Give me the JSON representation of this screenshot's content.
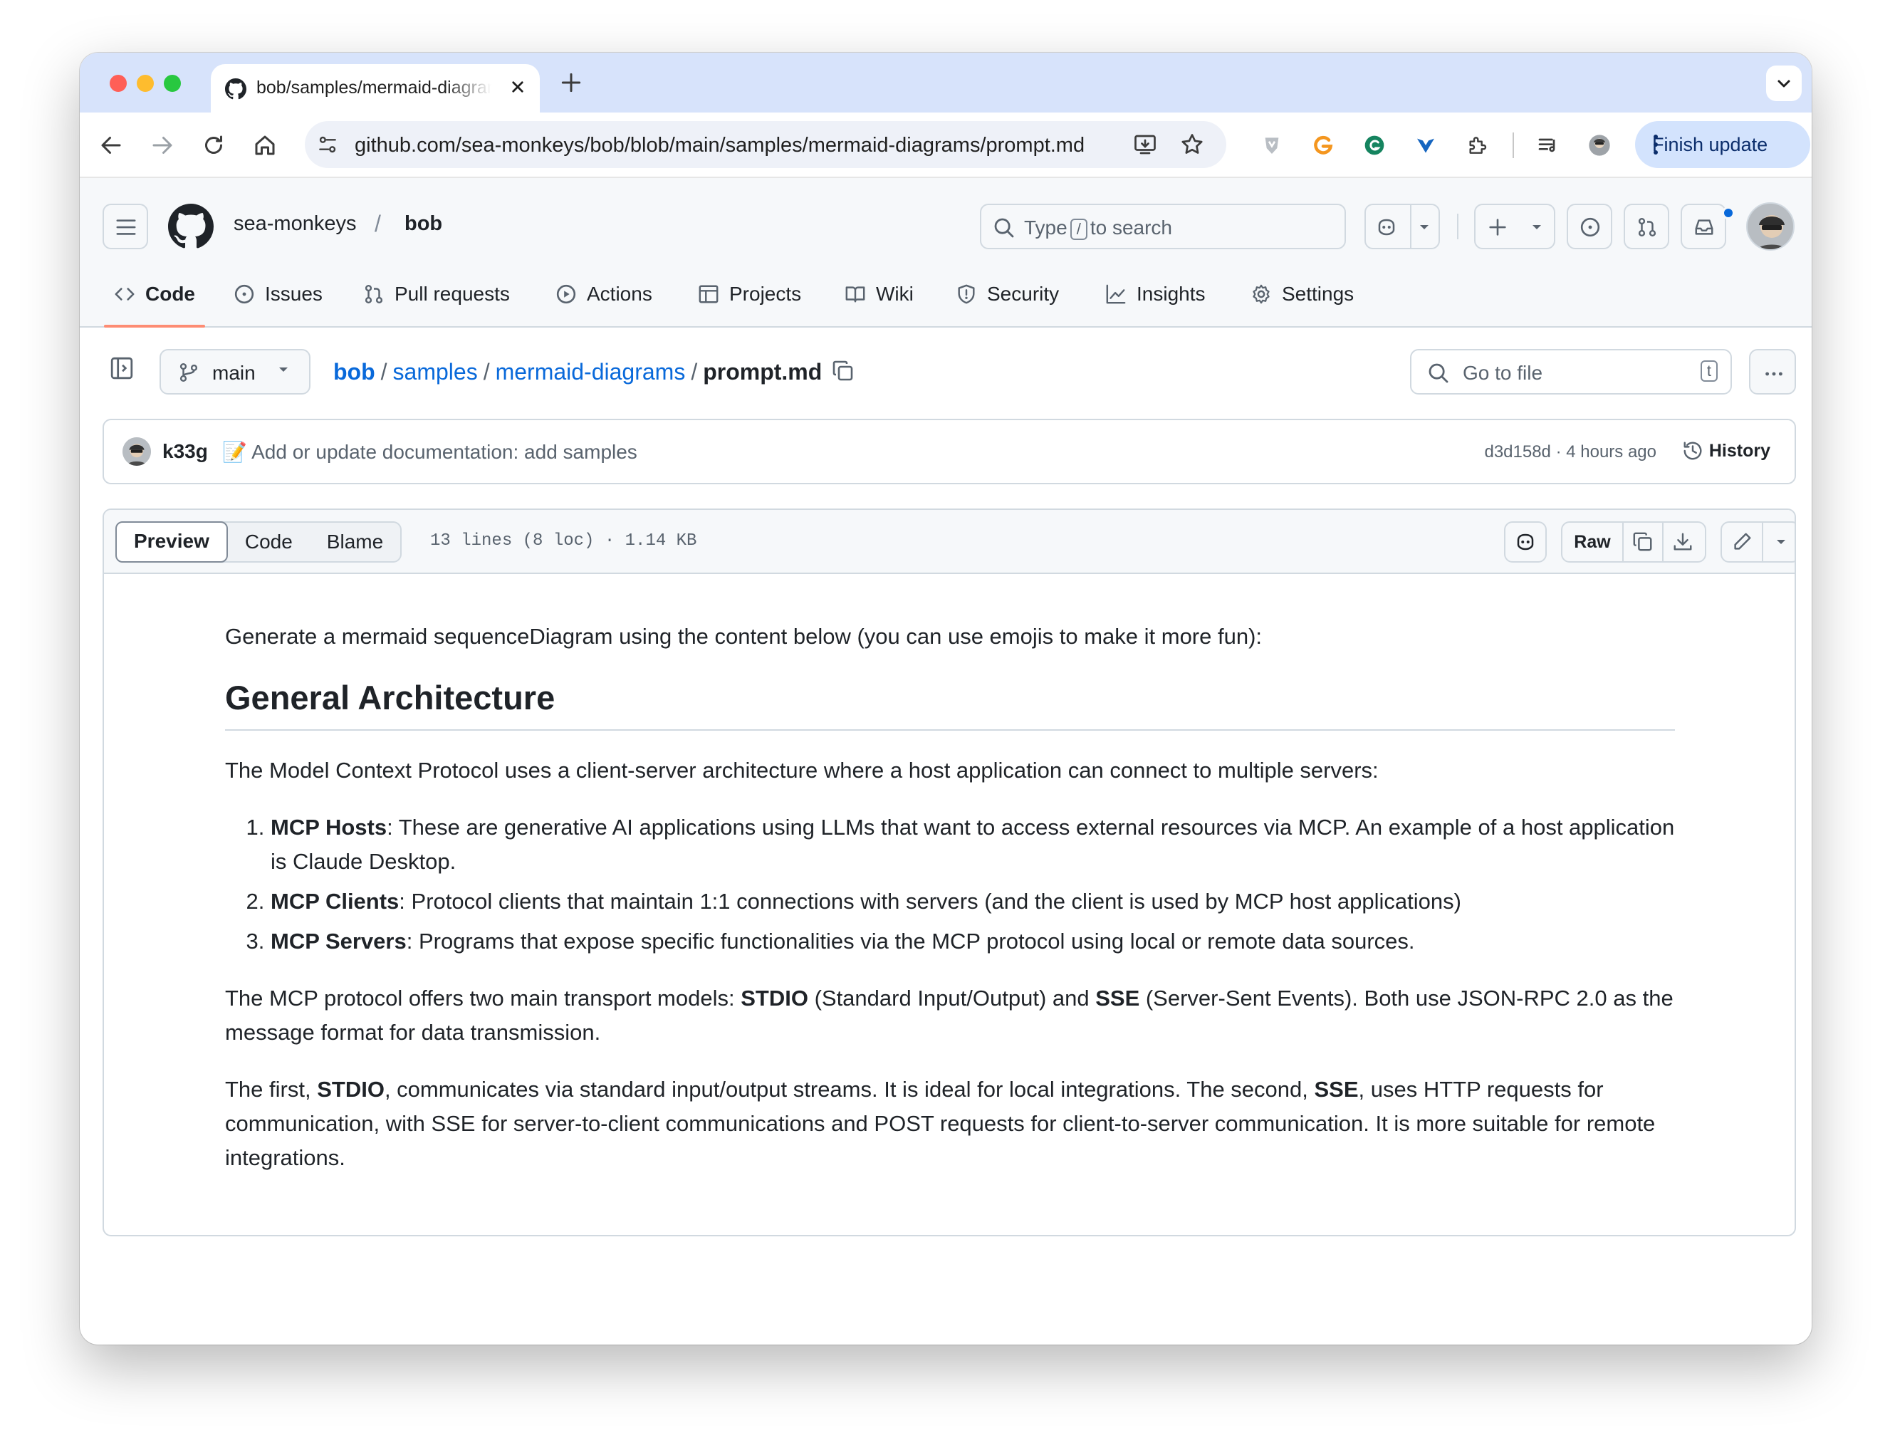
{
  "browser": {
    "tab_title": "bob/samples/mermaid-diagrams/prompt.md · sea-monkeys/bob",
    "url": "github.com/sea-monkeys/bob/blob/main/samples/mermaid-diagrams/prompt.md",
    "finish_update": "Finish update"
  },
  "repo": {
    "owner": "sea-monkeys",
    "name": "bob",
    "search_prefix": "Type",
    "search_key": "/",
    "search_suffix": "to search"
  },
  "nav": {
    "code": "Code",
    "issues": "Issues",
    "pulls": "Pull requests",
    "actions": "Actions",
    "projects": "Projects",
    "wiki": "Wiki",
    "security": "Security",
    "insights": "Insights",
    "settings": "Settings"
  },
  "file": {
    "branch": "main",
    "crumbs": [
      "bob",
      "samples",
      "mermaid-diagrams"
    ],
    "filename": "prompt.md",
    "goto": "Go to file",
    "goto_key": "t"
  },
  "commit": {
    "author": "k33g",
    "emoji": "📝",
    "message": "Add or update documentation: add samples",
    "hash_time": "d3d158d · 4 hours ago",
    "history": "History"
  },
  "viewer": {
    "preview": "Preview",
    "code": "Code",
    "blame": "Blame",
    "meta": "13 lines (8 loc) · 1.14 KB",
    "raw": "Raw"
  },
  "markdown": {
    "intro": "Generate a mermaid sequenceDiagram using the content below (you can use emojis to make it more fun):",
    "heading": "General Architecture",
    "para1": "The Model Context Protocol uses a client-server architecture where a host application can connect to multiple servers:",
    "items": [
      {
        "term": "MCP Hosts",
        "text": ": These are generative AI applications using LLMs that want to access external resources via MCP. An example of a host application is Claude Desktop."
      },
      {
        "term": "MCP Clients",
        "text": ": Protocol clients that maintain 1:1 connections with servers (and the client is used by MCP host applications)"
      },
      {
        "term": "MCP Servers",
        "text": ": Programs that expose specific functionalities via the MCP protocol using local or remote data sources."
      }
    ],
    "para2": {
      "a": "The MCP protocol offers two main transport models: ",
      "b1": "STDIO",
      "c": " (Standard Input/Output) and ",
      "b2": "SSE",
      "d": " (Server-Sent Events). Both use JSON-RPC 2.0 as the message format for data transmission."
    },
    "para3": {
      "a": "The first, ",
      "b1": "STDIO",
      "c": ", communicates via standard input/output streams. It is ideal for local integrations. The second, ",
      "b2": "SSE",
      "d": ", uses HTTP requests for communication, with SSE for server-to-client communications and POST requests for client-to-server communication. It is more suitable for remote integrations."
    }
  },
  "colors": {
    "link": "#0969da",
    "active_tab_underline": "#fd8c73",
    "tabstrip": "#d7e3fb",
    "finish_update_bg": "#d3e3fd"
  }
}
